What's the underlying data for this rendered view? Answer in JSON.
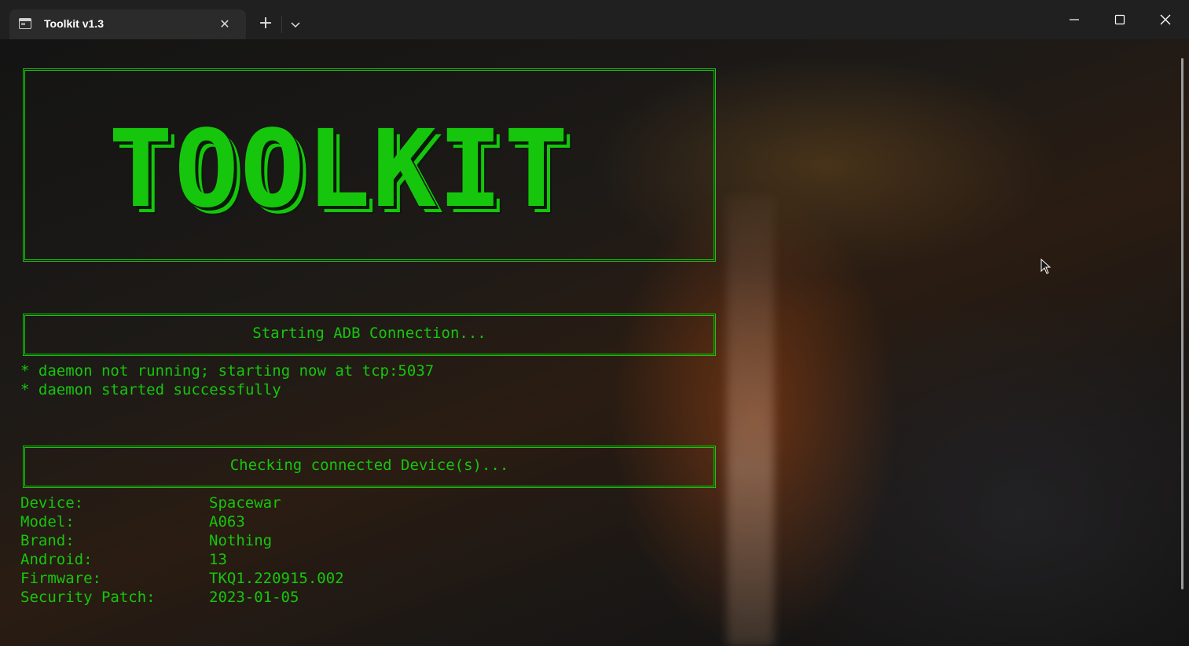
{
  "window": {
    "tab_title": "Toolkit v1.3",
    "tab_icon": "terminal-icon",
    "controls": [
      "minimize-icon",
      "maximize-icon",
      "close-icon"
    ]
  },
  "terminal": {
    "text_color": "#16c60c",
    "banner": "TOOLKIT",
    "adb_header": "Starting ADB Connection...",
    "adb_output": [
      "* daemon not running; starting now at tcp:5037",
      "* daemon started successfully"
    ],
    "device_header": "Checking connected Device(s)...",
    "device_info": [
      {
        "label": "Device:",
        "value": "Spacewar"
      },
      {
        "label": "Model:",
        "value": "A063"
      },
      {
        "label": "Brand:",
        "value": "Nothing"
      },
      {
        "label": "Android:",
        "value": "13"
      },
      {
        "label": "Firmware:",
        "value": "TKQ1.220915.002"
      },
      {
        "label": "Security Patch:",
        "value": "2023-01-05"
      }
    ]
  }
}
